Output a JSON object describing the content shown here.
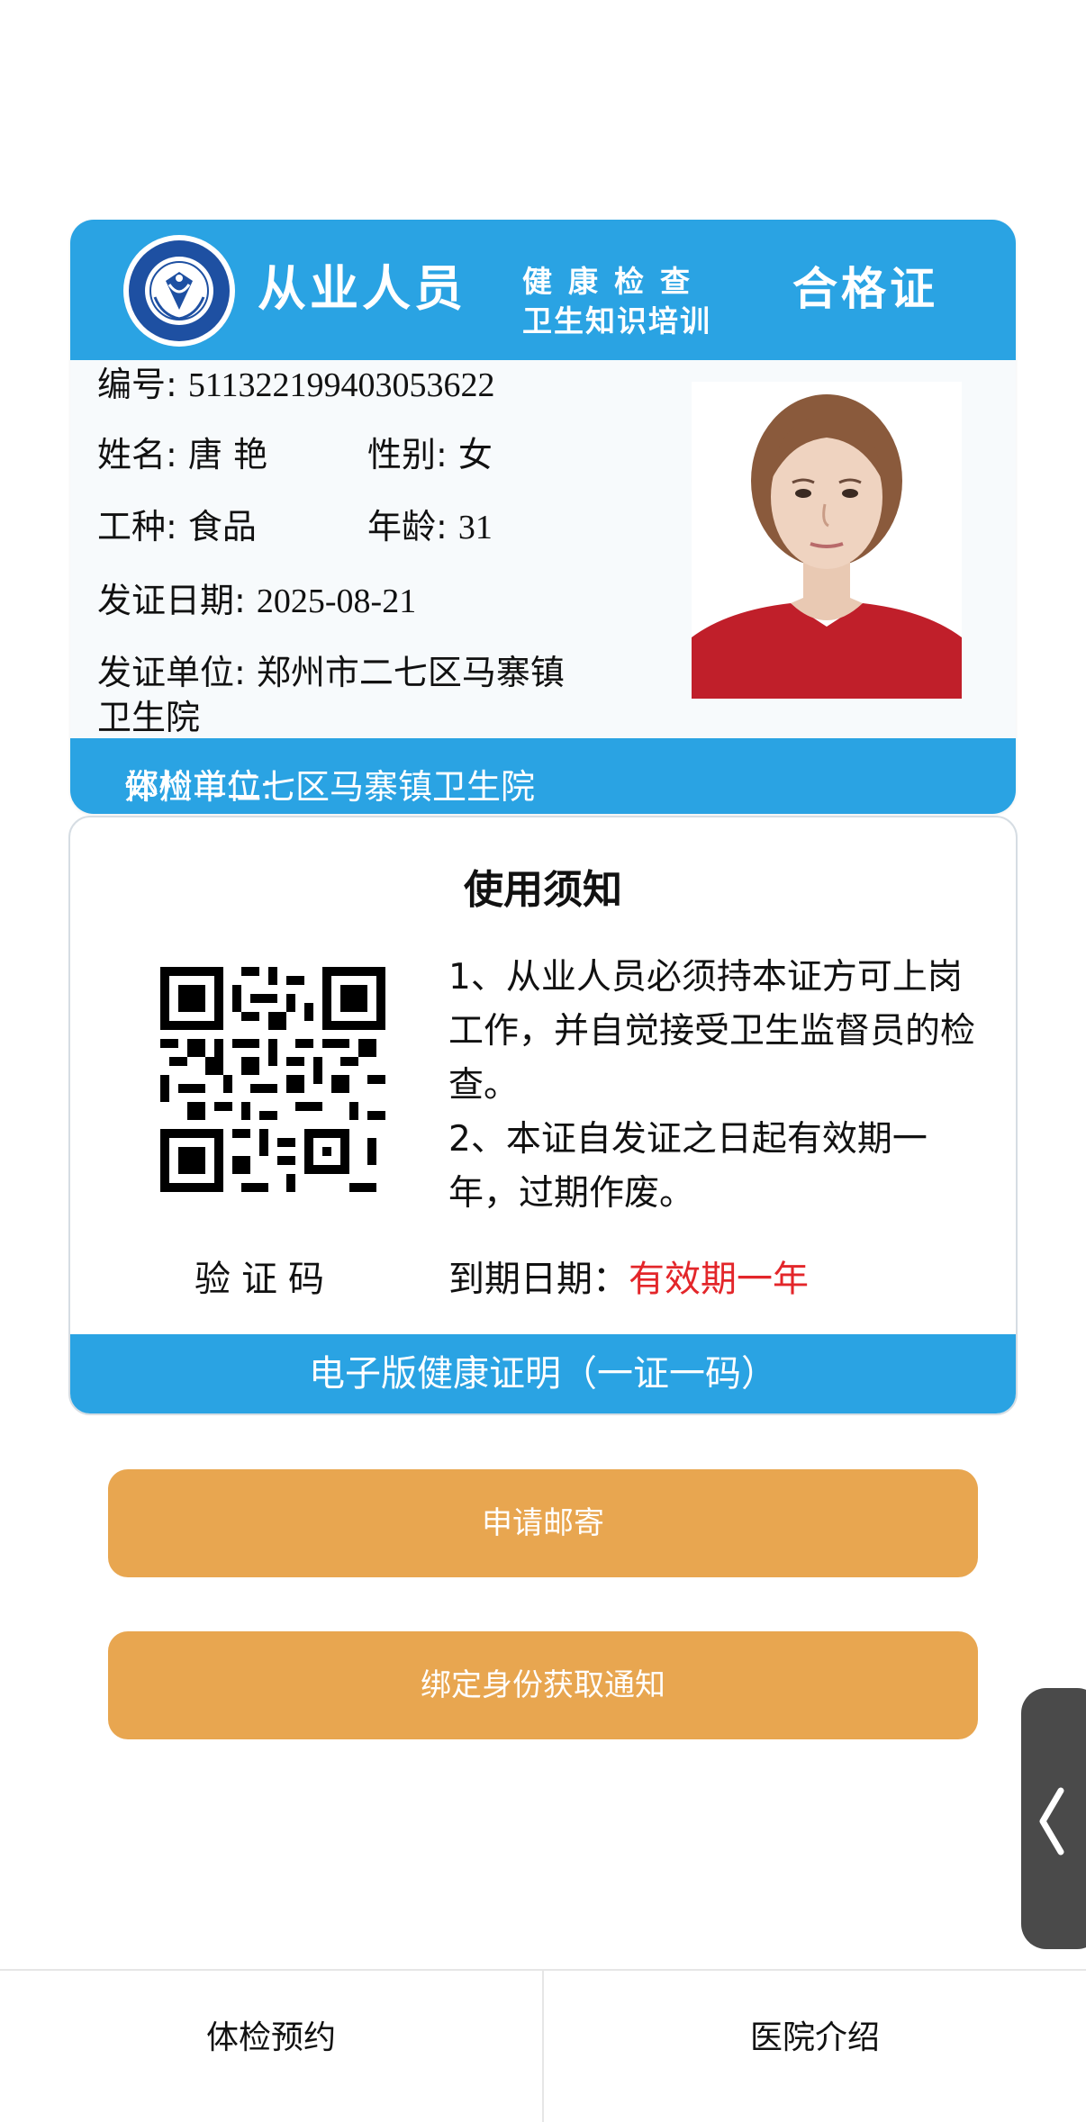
{
  "card": {
    "header": {
      "title": "从业人员",
      "sub_line1": "健康检查",
      "sub_line2": "卫生知识培训",
      "pass": "合格证"
    },
    "number_label": "编号:",
    "number_value": "511322199403053622",
    "name_label": "姓名:",
    "name_value": "唐 艳",
    "gender_label": "性别:",
    "gender_value": "女",
    "job_label": "工种:",
    "job_value": "食品",
    "age_label": "年龄:",
    "age_value": "31",
    "issue_date_label": "发证日期:",
    "issue_date_value": "2025-08-21",
    "issuer_label": "发证单位:",
    "issuer_value_line1": "郑州市二七区马寨镇",
    "issuer_value_line2": "卫生院",
    "exam_unit_label": "体检单位:",
    "exam_unit_value": "郑州市二七区马寨镇卫生院"
  },
  "notice": {
    "title": "使用须知",
    "rule1_line1": "1、从业人员必须持本证方可上岗",
    "rule1_line2": "工作，并自觉接受卫生监督员的检",
    "rule1_line3": "查。",
    "rule2_line1": "2、本证自发证之日起有效期一",
    "rule2_line2": "年，过期作废。",
    "verify_label": "验证码",
    "expiry_label": "到期日期：",
    "expiry_value": "有效期一年",
    "footer": "电子版健康证明（一证一码）"
  },
  "buttons": {
    "mail": "申请邮寄",
    "bind": "绑定身份获取通知"
  },
  "bottom_nav": {
    "left": "体检预约",
    "right": "医院介绍"
  },
  "colors": {
    "brand_blue": "#2aa3e3",
    "button_orange": "#e8a650",
    "expiry_red": "#e3262a"
  },
  "icons": {
    "emblem": "health-inspection-emblem",
    "qr": "qr-code",
    "side_tab": "chevron-left-icon"
  }
}
